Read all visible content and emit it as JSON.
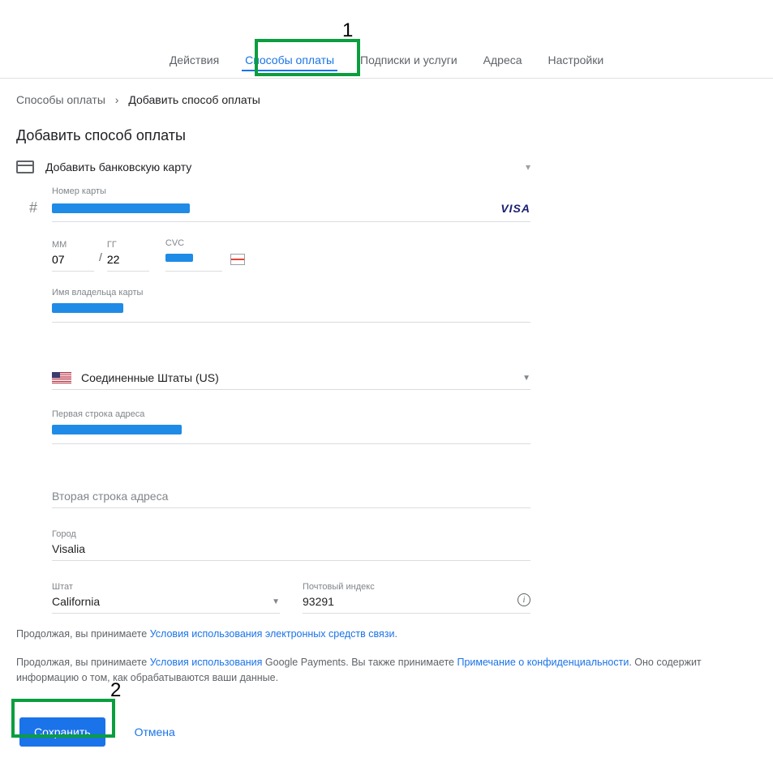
{
  "annotations": {
    "one": "1",
    "two": "2"
  },
  "nav": {
    "items": [
      {
        "label": "Действия"
      },
      {
        "label": "Способы оплаты"
      },
      {
        "label": "Подписки и услуги"
      },
      {
        "label": "Адреса"
      },
      {
        "label": "Настройки"
      }
    ]
  },
  "breadcrumb": {
    "root": "Способы оплаты",
    "sep": "›",
    "current": "Добавить способ оплаты"
  },
  "title": "Добавить способ оплаты",
  "method": {
    "label": "Добавить банковскую карту"
  },
  "card": {
    "number_label": "Номер карты",
    "brand": "VISA",
    "hash": "#",
    "mm_label": "ММ",
    "mm_value": "07",
    "yy_label": "ГГ",
    "yy_value": "22",
    "slash": "/",
    "cvc_label": "CVC",
    "name_label": "Имя владельца карты"
  },
  "address": {
    "country": "Соединенные Штаты (US)",
    "line1_label": "Первая строка адреса",
    "line2_label": "Вторая строка адреса",
    "city_label": "Город",
    "city_value": "Visalia",
    "state_label": "Штат",
    "state_value": "California",
    "zip_label": "Почтовый индекс",
    "zip_value": "93291"
  },
  "terms": {
    "line1_pre": "Продолжая, вы принимаете ",
    "line1_link": "Условия использования электронных средств связи",
    "line1_post": ".",
    "line2_pre": "Продолжая, вы принимаете ",
    "line2_link1": "Условия использования",
    "line2_mid1": " Google Payments. Вы также принимаете ",
    "line2_link2": "Примечание о конфиденциальности",
    "line2_post": ". Оно содержит информацию о том, как обрабатываются ваши данные."
  },
  "actions": {
    "save": "Сохранить",
    "cancel": "Отмена"
  }
}
